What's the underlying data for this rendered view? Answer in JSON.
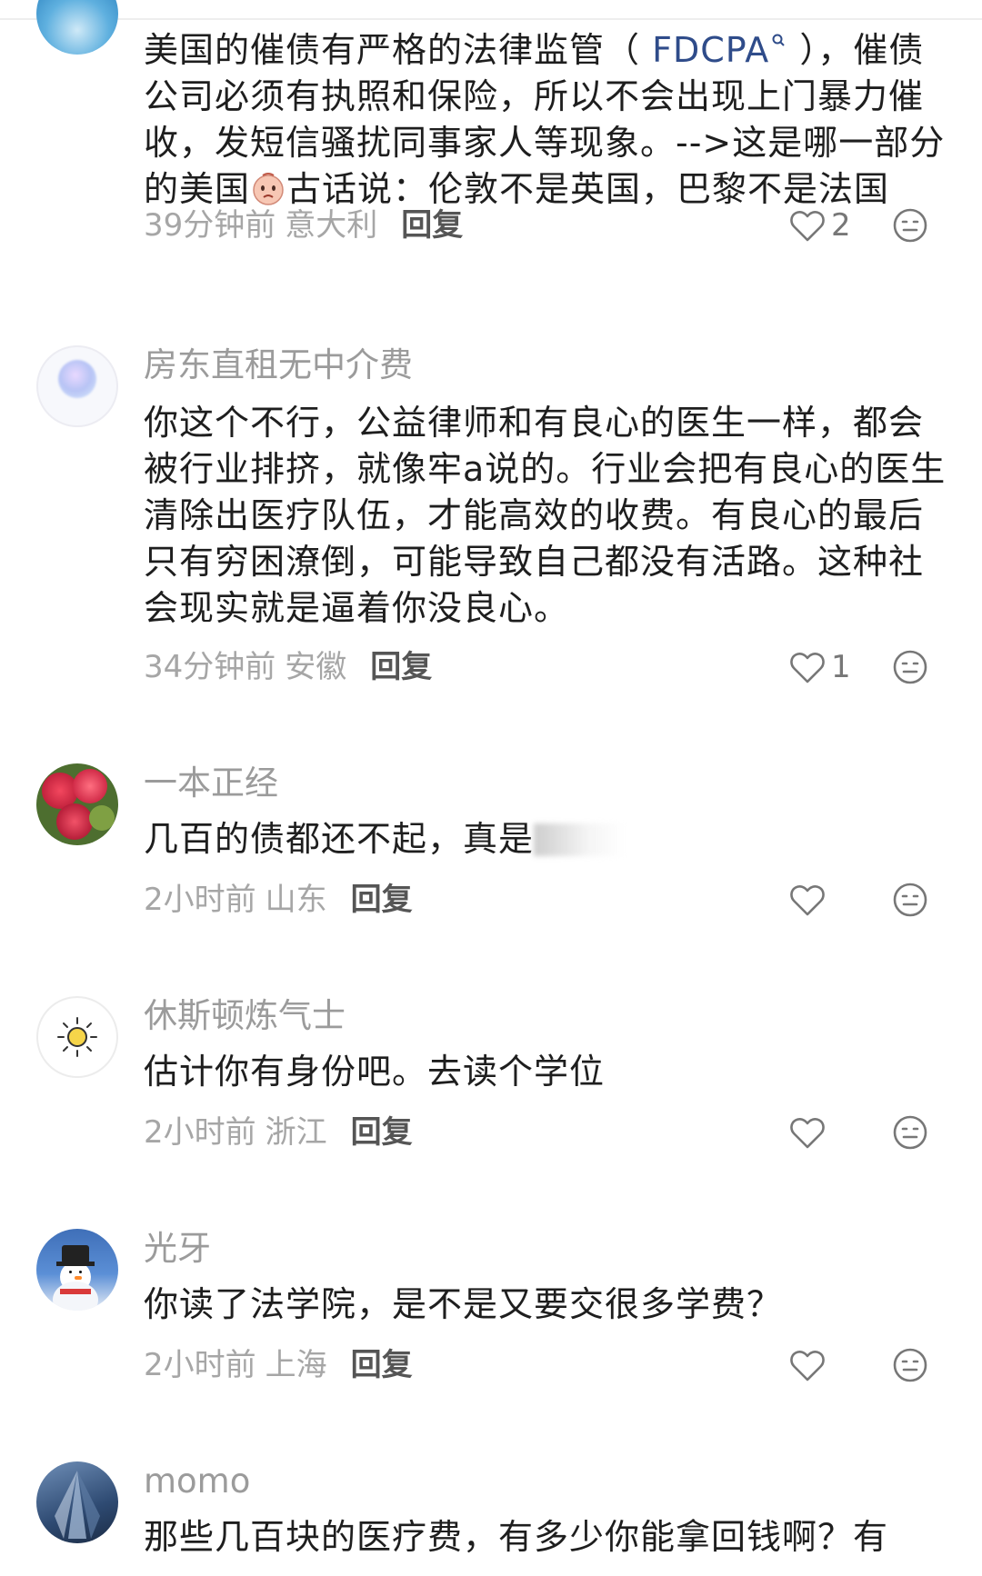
{
  "comments": [
    {
      "username": "",
      "content_before": "美国的催债有严格的法律监管（ ",
      "content_link": "FDCPA",
      "content_after": " ），催债公司必须有执照和保险，所以不会出现上门暴力催收，发短信骚扰同事家人等现象。-->这是哪一部分的美国",
      "content_tail": "古话说：伦敦不是英国，巴黎不是法国",
      "time": "39分钟前",
      "location": "意大利",
      "reply_label": "回复",
      "likes": "2",
      "avatar_icon": "ocean-avatar"
    },
    {
      "username": "房东直租无中介费",
      "content": "你这个不行，公益律师和有良心的医生一样，都会被行业排挤，就像牢a说的。行业会把有良心的医生清除出医疗队伍，才能高效的收费。有良心的最后只有穷困潦倒，可能导致自己都没有活路。这种社会现实就是逼着你没良心。",
      "time": "34分钟前",
      "location": "安徽",
      "reply_label": "回复",
      "likes": "1",
      "avatar_icon": "bubble-avatar"
    },
    {
      "username": "一本正经",
      "content": "几百的债都还不起，真是",
      "time": "2小时前",
      "location": "山东",
      "reply_label": "回复",
      "likes": "",
      "avatar_icon": "flower-avatar"
    },
    {
      "username": "休斯顿炼气士",
      "content": "估计你有身份吧。去读个学位",
      "time": "2小时前",
      "location": "浙江",
      "reply_label": "回复",
      "likes": "",
      "avatar_icon": "sun-avatar"
    },
    {
      "username": "光牙",
      "content": "你读了法学院，是不是又要交很多学费？",
      "time": "2小时前",
      "location": "上海",
      "reply_label": "回复",
      "likes": "",
      "avatar_icon": "snowman-avatar"
    },
    {
      "username": "momo",
      "content": "那些几百块的医疗费，有多少你能拿回钱啊？有",
      "avatar_icon": "building-avatar"
    }
  ],
  "colors": {
    "username": "#9b9b9b",
    "content": "#1e1e1e",
    "meta": "#a6a6a6",
    "reply": "#555555",
    "link": "#2f4c8a"
  }
}
